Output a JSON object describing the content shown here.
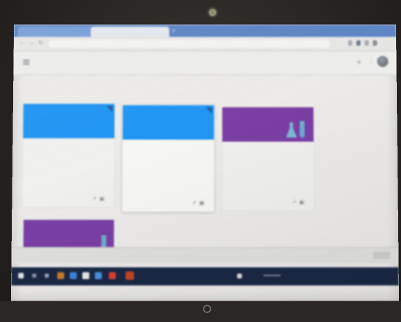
{
  "browser": {
    "tabs": [
      {
        "label": "",
        "active": false
      },
      {
        "label": "",
        "active": true
      }
    ],
    "address": ""
  },
  "app": {
    "title": ""
  },
  "subnav": {
    "items": [
      "",
      ""
    ]
  },
  "cards": [
    {
      "title": "",
      "subtitle": "",
      "color": "#2196f3"
    },
    {
      "title": "",
      "subtitle": "",
      "color": "#2196f3"
    },
    {
      "title": "",
      "subtitle": "",
      "color": "#7b3fa5"
    },
    {
      "title": "",
      "subtitle": "",
      "color": "#7b3fa5"
    }
  ],
  "downloads": {
    "items": [
      "",
      ""
    ]
  },
  "taskbar": {
    "tray_time": ""
  },
  "colors": {
    "chrome_blue": "#5e85c4",
    "card_blue": "#2196f3",
    "card_purple": "#7b3fa5",
    "taskbar": "#1b2946",
    "bezel": "#2d2a28"
  },
  "icons": [
    "menu-icon",
    "plus-icon",
    "apps-icon",
    "edit-icon",
    "folder-icon",
    "power-icon",
    "webcam-icon"
  ]
}
